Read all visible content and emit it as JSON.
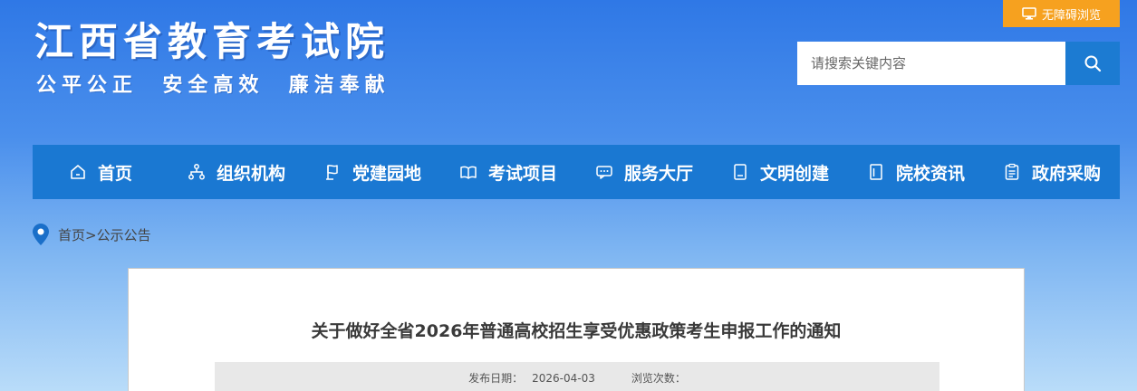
{
  "header": {
    "title": "江西省教育考试院",
    "slogan": "公平公正  安全高效  廉洁奉献",
    "accessibility_label": "无障碍浏览",
    "search_placeholder": "请搜索关键内容"
  },
  "nav": {
    "items": [
      {
        "label": "首页",
        "icon": "home-icon"
      },
      {
        "label": "组织机构",
        "icon": "org-chart-icon"
      },
      {
        "label": "党建园地",
        "icon": "flag-icon"
      },
      {
        "label": "考试项目",
        "icon": "book-icon"
      },
      {
        "label": "服务大厅",
        "icon": "chat-icon"
      },
      {
        "label": "文明创建",
        "icon": "notebook-icon"
      },
      {
        "label": "院校资讯",
        "icon": "document-icon"
      },
      {
        "label": "政府采购",
        "icon": "clipboard-icon"
      }
    ]
  },
  "breadcrumb": {
    "home": "首页",
    "separator": ">",
    "current": "公示公告"
  },
  "article": {
    "title": "关于做好全省2026年普通高校招生享受优惠政策考生申报工作的通知",
    "date_label": "发布日期：",
    "date": "2026-04-03",
    "views_label": "浏览次数："
  },
  "colors": {
    "nav_bg": "#1a78d2",
    "accessibility_bg": "#f6a11f",
    "search_button_bg": "#1c7bd2",
    "location_pin": "#1a6fc9"
  }
}
